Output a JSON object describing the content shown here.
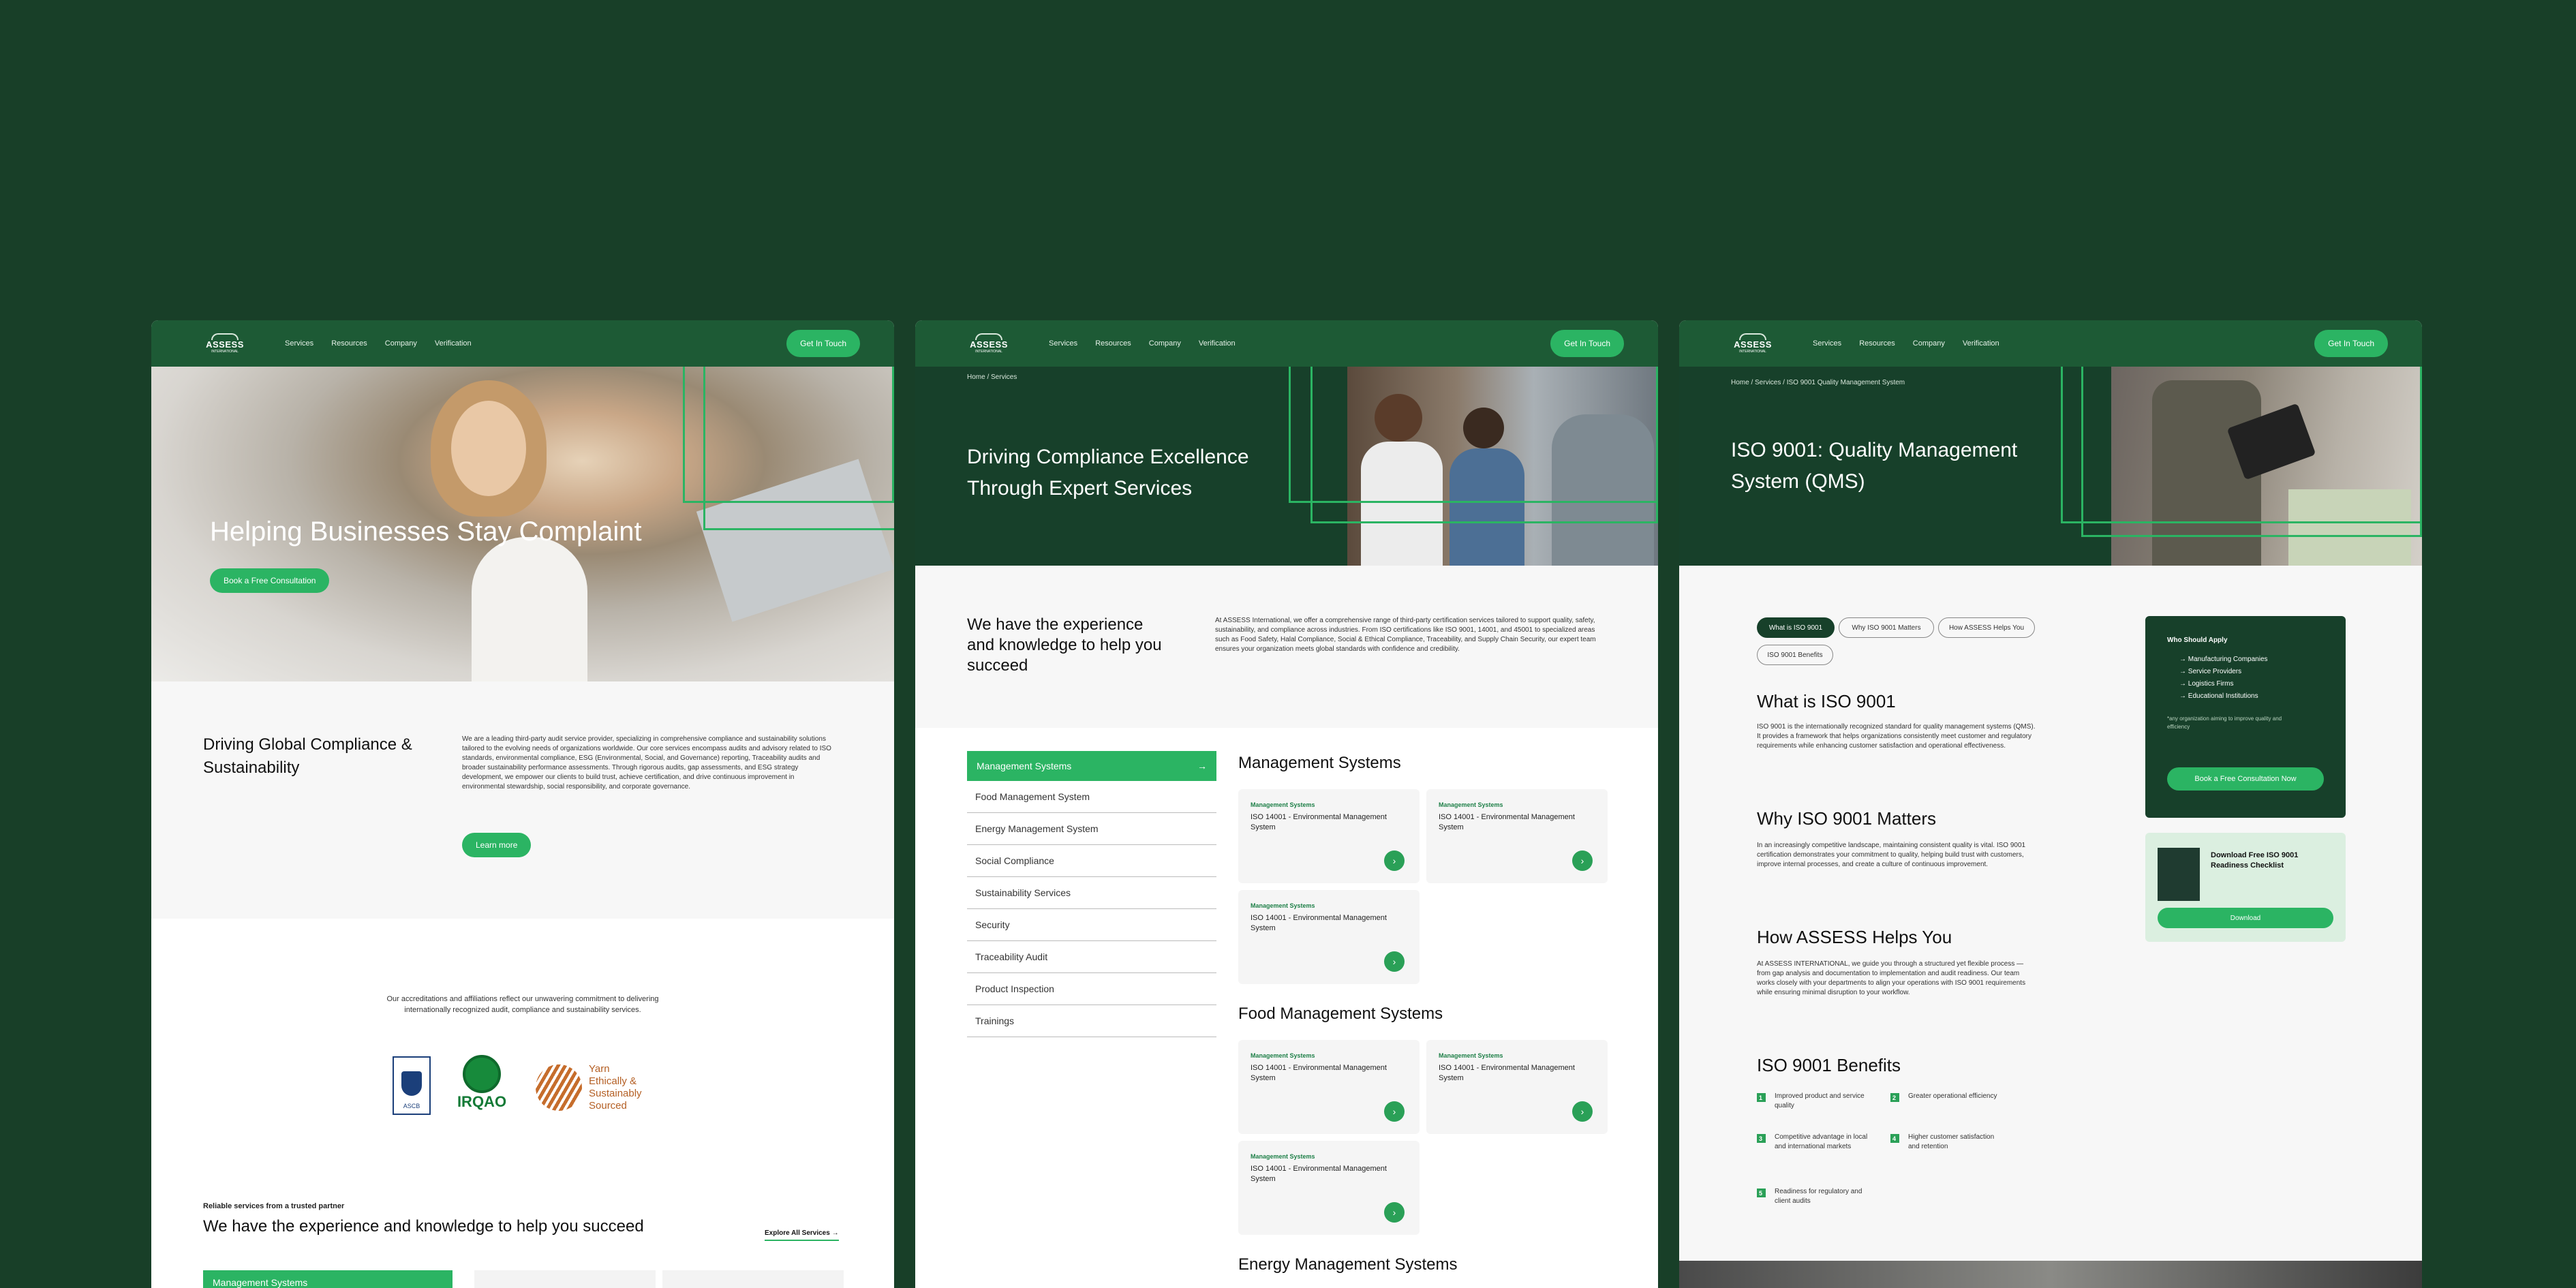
{
  "nav": {
    "logo": "ASSESS",
    "logo_sub": "INTERNATIONAL",
    "items": [
      "Services",
      "Resources",
      "Company",
      "Verification"
    ],
    "cta": "Get In Touch"
  },
  "page1": {
    "hero_title": "Helping Businesses Stay Complaint",
    "hero_cta": "Book a Free Consultation",
    "intro_heading": "Driving Global Compliance & Sustainability",
    "intro_text": "We are a leading third-party audit service provider, specializing in comprehensive compliance and sustainability solutions tailored to the evolving needs of organizations worldwide. Our core services encompass audits and advisory related to ISO standards, environmental compliance, ESG (Environmental, Social, and Governance) reporting, Traceability audits and broader sustainability performance assessments. Through rigorous audits, gap assessments, and ESG strategy development, we empower our clients to build trust, achieve certification, and drive continuous improvement in environmental stewardship, social responsibility, and corporate governance.",
    "learn_more": "Learn more",
    "accred_text": "Our accreditations and affiliations reflect our unwavering commitment to delivering internationally recognized audit, compliance and sustainability services.",
    "logos": {
      "ascb": "ASCB",
      "irqao": "IRQAO",
      "yarn": "Yarn Ethically & Sustainably Sourced"
    },
    "eyebrow": "Reliable services from a trusted partner",
    "bottom_heading": "We have the experience and knowledge to help you succeed",
    "explore": "Explore All Services",
    "first_service": "Management Systems"
  },
  "page2": {
    "breadcrumb": "Home / Services",
    "hero_title": "Driving Compliance Excellence Through Expert Services",
    "intro_heading": "We have the experience and knowledge to help you succeed",
    "intro_text": "At ASSESS International, we offer a comprehensive range of third-party certification services tailored to support quality, safety, sustainability, and compliance across industries. From ISO certifications like ISO 9001, 14001, and 45001 to specialized areas such as Food Safety, Halal Compliance, Social & Ethical Compliance, Traceability, and Supply Chain Security, our expert team ensures your organization meets global standards with confidence and credibility.",
    "categories": [
      "Management Systems",
      "Food Management System",
      "Energy Management System",
      "Social Compliance",
      "Sustainability Services",
      "Security",
      "Traceability Audit",
      "Product Inspection",
      "Trainings"
    ],
    "sections": [
      "Management Systems",
      "Food Management Systems",
      "Energy Management Systems"
    ],
    "card_kicker": "Management Systems",
    "card_title": "ISO 14001 - Environmental Management System"
  },
  "page3": {
    "breadcrumb": "Home / Services / ISO 9001 Quality Management System",
    "hero_title": "ISO 9001: Quality Management System (QMS)",
    "tabs": [
      "What is ISO 9001",
      "Why ISO 9001 Matters",
      "How ASSESS Helps You",
      "ISO 9001 Benefits"
    ],
    "what_h": "What is ISO 9001",
    "what_p": "ISO 9001 is the internationally recognized standard for quality management systems (QMS). It provides a framework that helps organizations consistently meet customer and regulatory requirements while enhancing customer satisfaction and operational effectiveness.",
    "why_h": "Why ISO 9001 Matters",
    "why_p": "In an increasingly competitive landscape, maintaining consistent quality is vital. ISO 9001 certification demonstrates your commitment to quality, helping build trust with customers, improve internal processes, and create a culture of continuous improvement.",
    "how_h": "How ASSESS Helps You",
    "how_p": "At ASSESS INTERNATIONAL, we guide you through a structured yet flexible process — from gap analysis and documentation to implementation and audit readiness. Our team works closely with your departments to align your operations with ISO 9001 requirements while ensuring minimal disruption to your workflow.",
    "ben_h": "ISO 9001 Benefits",
    "benefits": [
      "Improved product and service quality",
      "Greater operational efficiency",
      "Competitive advantage in local and international markets",
      "Higher customer satisfaction and retention",
      "Readiness for regulatory and client audits"
    ],
    "side_title": "Who Should Apply",
    "side_items": [
      "Manufacturing Companies",
      "Service Providers",
      "Logistics Firms",
      "Educational Institutions"
    ],
    "side_note": "*any organization aiming to improve quality and efficiency",
    "side_cta": "Book a Free Consultation Now",
    "dl_title": "Download Free ISO 9001 Readiness Checklist",
    "dl_btn": "Download"
  }
}
